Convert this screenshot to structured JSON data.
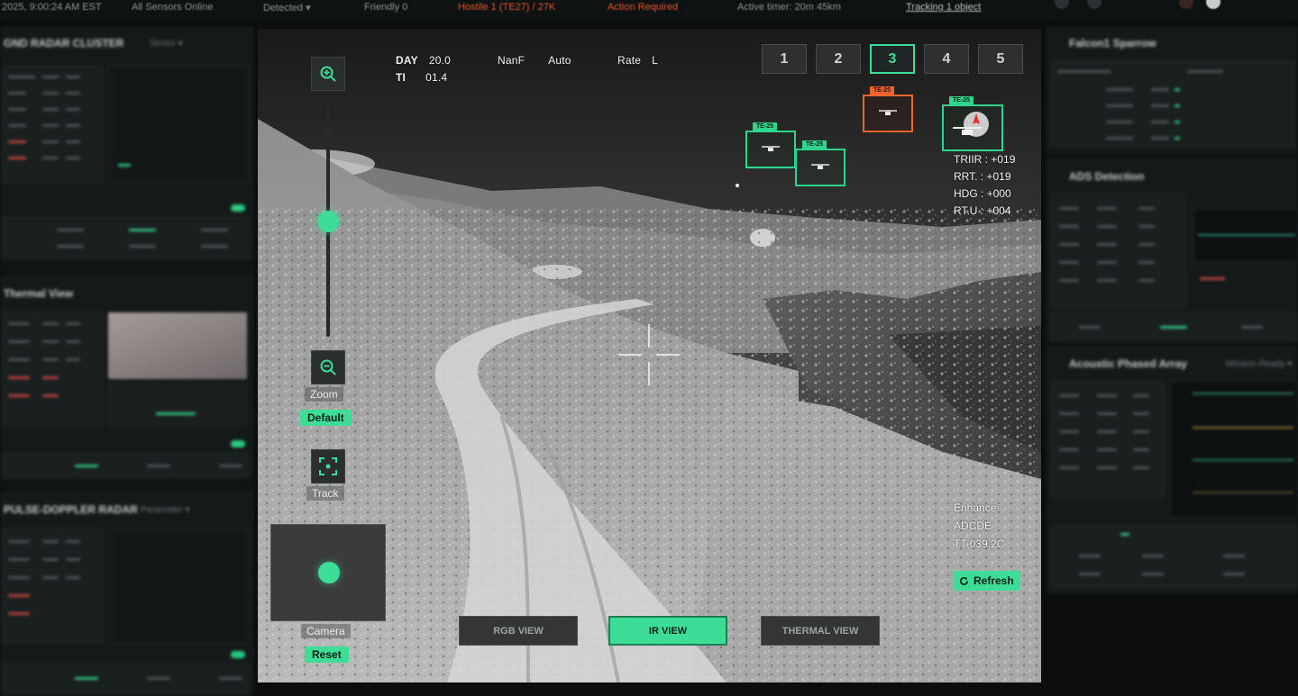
{
  "topbar": {
    "datetime": "2025, 9:00:24 AM EST",
    "items": [
      "All Sensors Online",
      "Detected  ▾",
      "Friendly 0"
    ],
    "alerts": [
      "Hostile 1 (TE27) / 27K",
      "Action Required"
    ],
    "active_timer": "Active timer: 20m 45km",
    "tracking": "Tracking 1 object"
  },
  "left_panels": {
    "radar_cluster": "GND RADAR CLUSTER",
    "thermal_view": "Thermal View",
    "doppler_radar": "PULSE-DOPPLER RADAR"
  },
  "right_panels": {
    "falcon": "Falcon1 Sparrow",
    "ads_detection": "ADS Detection",
    "acoustic": "Acoustic Phased Array"
  },
  "hud": {
    "day_label": "DAY",
    "day_value": "20.0",
    "ti_label": "TI",
    "ti_value": "01.4",
    "nanf_label": "NanF",
    "nanf_value": "Auto",
    "rate_label": "Rate",
    "rate_value": "L"
  },
  "camera_tabs": [
    "1",
    "2",
    "3",
    "4",
    "5"
  ],
  "active_camera": "3",
  "controls": {
    "zoom_label": "Zoom",
    "zoom_default": "Default",
    "track_label": "Track",
    "camera_label": "Camera",
    "camera_reset": "Reset",
    "zoom_level_fraction": 0.55
  },
  "targets": [
    {
      "id": "TE-25",
      "status": "friendly"
    },
    {
      "id": "TE-25",
      "status": "friendly"
    },
    {
      "id": "TE-25",
      "status": "hostile"
    },
    {
      "id": "TE-25",
      "status": "friendly"
    }
  ],
  "telemetry": [
    {
      "label": "TRIIR",
      "value": "+019"
    },
    {
      "label": "RRT.",
      "value": "+019"
    },
    {
      "label": "HDG",
      "value": "+000"
    },
    {
      "label": "RT.U",
      "value": "+004"
    }
  ],
  "enhance": {
    "line1": "Enhance",
    "line2": "ADCDE",
    "line3": "TT 039.2C",
    "refresh": "Refresh"
  },
  "view_modes": [
    "RGB VIEW",
    "IR VIEW",
    "THERMAL VIEW"
  ],
  "active_view": "IR VIEW",
  "colors": {
    "accent": "#3ddc97",
    "hostile": "#f0652e",
    "background": "#0b0d0e"
  }
}
